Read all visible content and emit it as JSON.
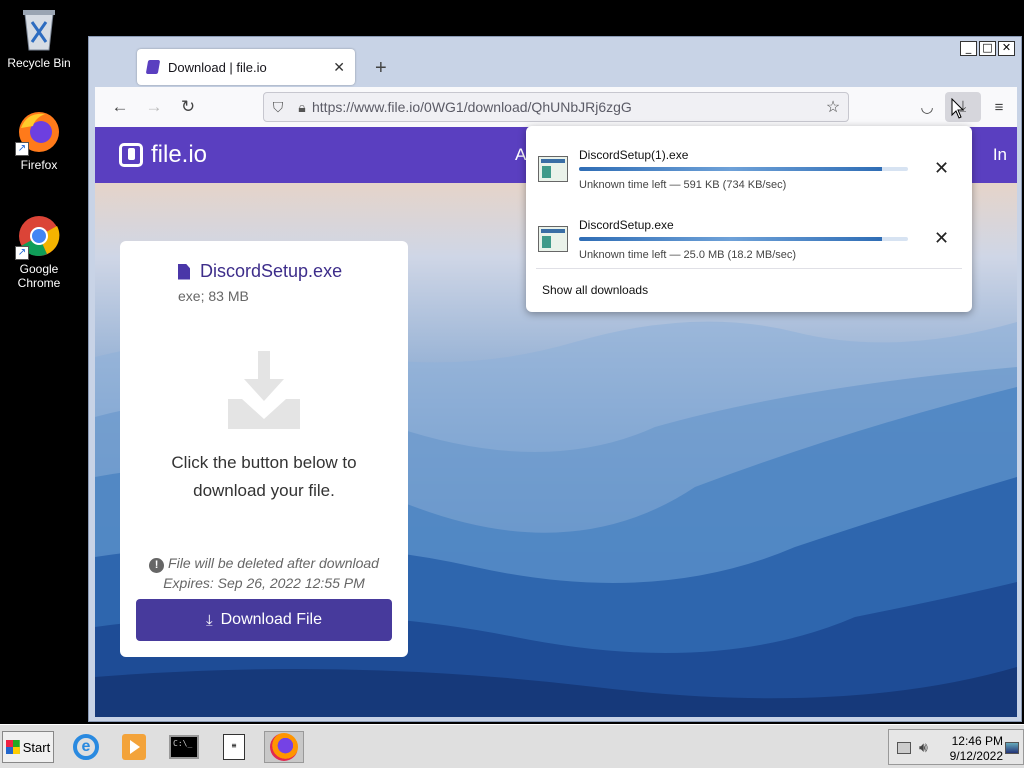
{
  "desktop": {
    "icons": [
      {
        "label": "Recycle Bin"
      },
      {
        "label": "Firefox"
      },
      {
        "label": "Google Chrome"
      }
    ]
  },
  "browser": {
    "tab": {
      "title": "Download | file.io"
    },
    "url": "https://www.file.io/0WG1/download/QhUNbJRj6zgG"
  },
  "site": {
    "logo": "file.io",
    "header_left_fragment": "A",
    "header_right_fragment": "In",
    "card": {
      "file_name": "DiscordSetup.exe",
      "file_meta": "exe; 83 MB",
      "message": "Click the button below to download your file.",
      "note_line1": "File will be deleted after download",
      "note_line2": "Expires: Sep 26, 2022 12:55 PM",
      "button": "Download File"
    }
  },
  "downloads": {
    "items": [
      {
        "name": "DiscordSetup(1).exe",
        "status": "Unknown time left — 591 KB (734 KB/sec)",
        "progress": 0.92
      },
      {
        "name": "DiscordSetup.exe",
        "status": "Unknown time left — 25.0 MB (18.2 MB/sec)",
        "progress": 0.92
      }
    ],
    "show_all": "Show all downloads"
  },
  "taskbar": {
    "start": "Start",
    "time": "12:46 PM",
    "date": "9/12/2022"
  },
  "colors": {
    "brand": "#5a3fc0",
    "button": "#473a9c"
  }
}
